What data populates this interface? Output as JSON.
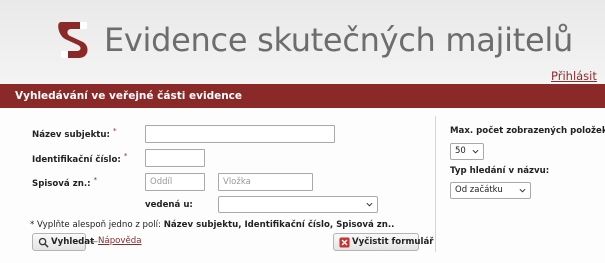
{
  "header": {
    "title": "Evidence skutečných majitelů",
    "login_link": "Přihlásit",
    "logo_icon": "esm-logo-icon",
    "brand_color": "#8b2828"
  },
  "section": {
    "title": "Vyhledávání ve veřejné části evidence"
  },
  "form": {
    "subject_name_label": "Název subjektu:",
    "ico_label": "Identifikační číslo:",
    "file_no_label": "Spisová zn.:",
    "required_mark": "*",
    "department_placeholder": "Oddíl",
    "insert_placeholder": "Vložka",
    "court_label": "vedená u:",
    "court_value": "",
    "note_prefix": "* Vyplňte alespoň jedno z polí: ",
    "note_fields": "Název subjektu, Identifikační číslo, Spisová zn..",
    "search_button": "Vyhledat",
    "separator": "—",
    "help_link": "Nápověda",
    "clear_button": "Vyčistit formulář"
  },
  "options": {
    "max_items_label": "Max. počet zobrazených položek:",
    "max_items_value": "50",
    "search_type_label": "Typ hledání v názvu:",
    "search_type_value": "Od začátku"
  }
}
